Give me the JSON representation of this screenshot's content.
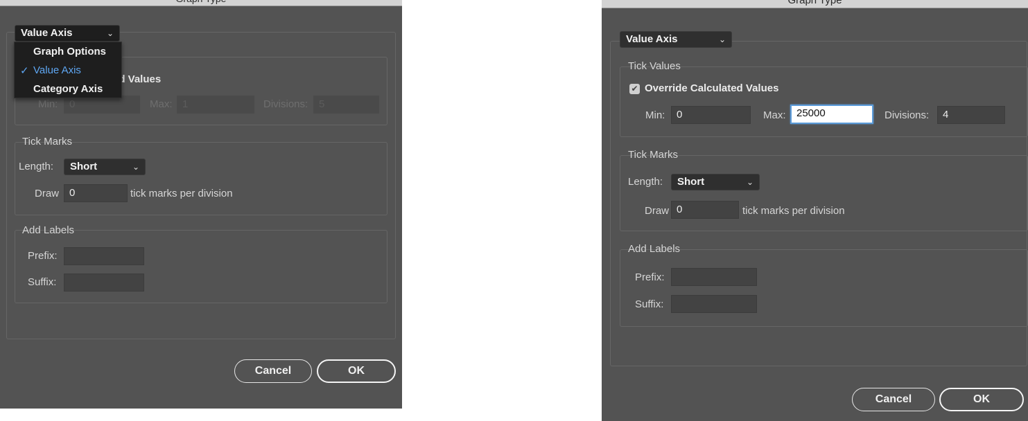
{
  "dialog_title": "Graph Type",
  "section_select": {
    "selected": "Value Axis",
    "options": [
      "Graph Options",
      "Value Axis",
      "Category Axis"
    ]
  },
  "tick_values": {
    "title": "Tick Values",
    "override_label": "Override Calculated Values",
    "override_partial": "ted Values",
    "override_checked": true,
    "min_label": "Min:",
    "max_label": "Max:",
    "divisions_label": "Divisions:",
    "left": {
      "min": "0",
      "max": "1",
      "divisions": "5"
    },
    "right": {
      "min": "0",
      "max": "25000",
      "divisions": "4"
    }
  },
  "tick_marks": {
    "title": "Tick Marks",
    "length_label": "Length:",
    "length_value": "Short",
    "draw_label": "Draw",
    "draw_value": "0",
    "per_division_label": "tick marks per division"
  },
  "add_labels": {
    "title": "Add Labels",
    "prefix_label": "Prefix:",
    "prefix_value": "",
    "suffix_label": "Suffix:",
    "suffix_value": ""
  },
  "buttons": {
    "cancel": "Cancel",
    "ok": "OK"
  },
  "icons": {
    "checkmark": "✓",
    "chevron": "⌄",
    "checkbox": "✔"
  },
  "colors": {
    "dialog_bg": "#535353",
    "menu_bg": "#1e1e1e",
    "menu_selected": "#5fa7f3",
    "focus_ring": "#5b9bd9"
  }
}
